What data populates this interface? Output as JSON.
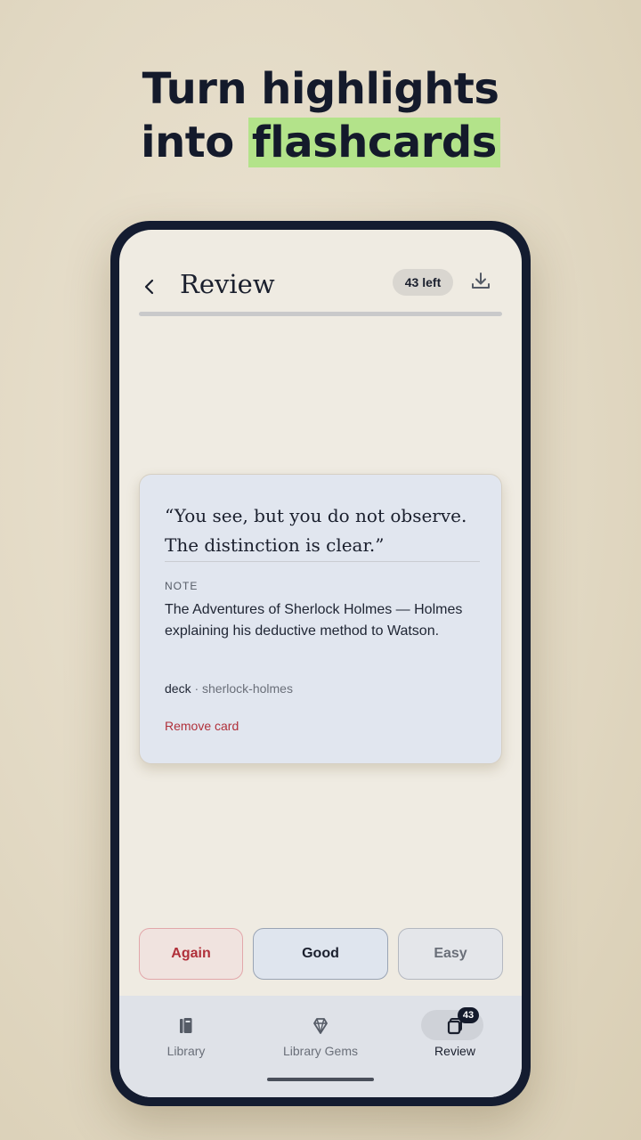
{
  "headline": {
    "line1": "Turn highlights",
    "line2_prefix": "into ",
    "line2_highlight": "flashcards"
  },
  "header": {
    "title": "Review",
    "remaining": "43 left",
    "back_icon": "chevron-left-icon",
    "download_icon": "download-icon"
  },
  "progress": {
    "fraction": 0.0
  },
  "card": {
    "quote": "“You see, but you do not observe. The distinction is clear.”",
    "note_label": "NOTE",
    "note_text": "The Adventures of Sherlock Holmes — Holmes explaining his deductive method to Watson.",
    "deck_label": "deck",
    "deck_value": "· sherlock-holmes",
    "remove_label": "Remove card"
  },
  "actions": {
    "again": "Again",
    "good": "Good",
    "easy": "Easy"
  },
  "nav": {
    "items": [
      {
        "label": "Library",
        "icon": "library-icon"
      },
      {
        "label": "Library Gems",
        "icon": "gem-icon"
      },
      {
        "label": "Review",
        "icon": "cards-icon",
        "badge": "43",
        "active": true
      }
    ]
  },
  "colors": {
    "accent": "#b3e38a",
    "danger": "#b0303a",
    "frame": "#141c30"
  }
}
